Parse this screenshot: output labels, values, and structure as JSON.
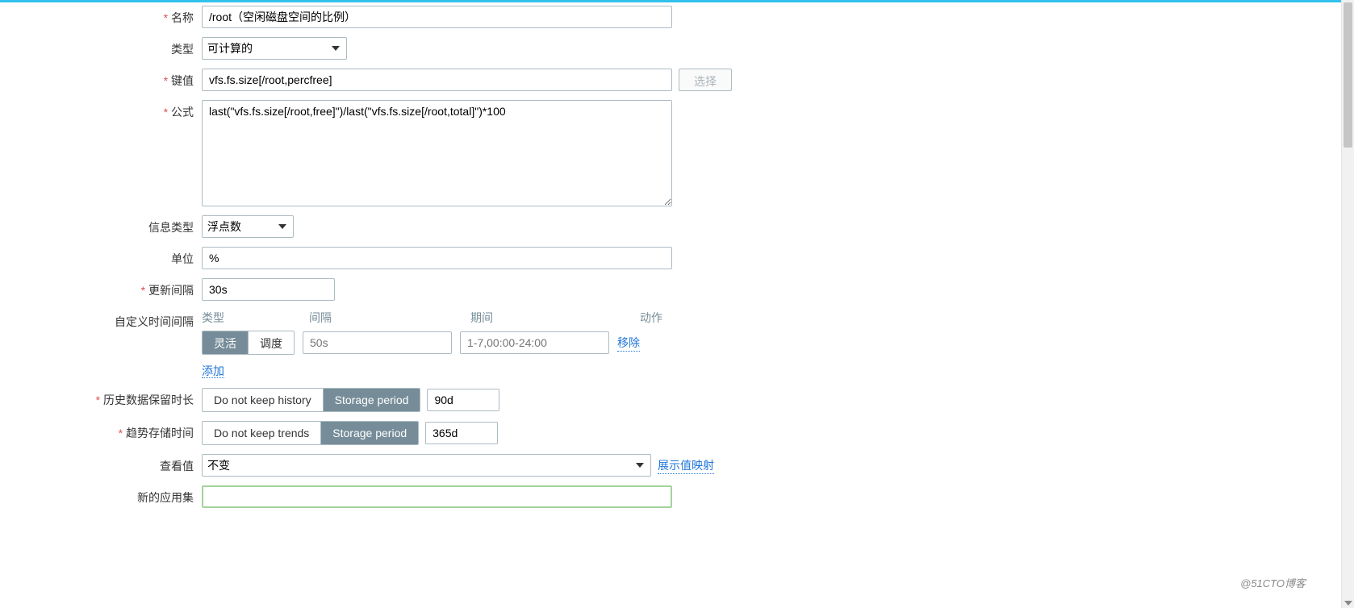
{
  "form": {
    "name": {
      "label": "名称",
      "value": "/root（空闲磁盘空间的比例）"
    },
    "type": {
      "label": "类型",
      "value": "可计算的"
    },
    "key": {
      "label": "键值",
      "value": "vfs.fs.size[/root,percfree]",
      "select_btn": "选择"
    },
    "formula": {
      "label": "公式",
      "value": "last(\"vfs.fs.size[/root,free]\")/last(\"vfs.fs.size[/root,total]\")*100"
    },
    "info_type": {
      "label": "信息类型",
      "value": "浮点数"
    },
    "unit": {
      "label": "单位",
      "value": "%"
    },
    "update_interval": {
      "label": "更新间隔",
      "value": "30s"
    },
    "custom_intervals": {
      "label": "自定义时间间隔",
      "headers": {
        "type": "类型",
        "interval": "间隔",
        "period": "期间",
        "action": "动作"
      },
      "type_options": {
        "flexible": "灵活",
        "scheduling": "调度"
      },
      "type_selected": "flexible",
      "interval_placeholder": "50s",
      "interval_value": "",
      "period_placeholder": "1-7,00:00-24:00",
      "period_value": "",
      "remove": "移除",
      "add": "添加"
    },
    "history": {
      "label": "历史数据保留时长",
      "options": {
        "no_keep": "Do not keep history",
        "storage": "Storage period"
      },
      "selected": "storage",
      "value": "90d"
    },
    "trends": {
      "label": "趋势存储时间",
      "options": {
        "no_keep": "Do not keep trends",
        "storage": "Storage period"
      },
      "selected": "storage",
      "value": "365d"
    },
    "view": {
      "label": "查看值",
      "value": "不变",
      "show_map": "展示值映射"
    },
    "new_appset": {
      "label": "新的应用集",
      "value": ""
    }
  },
  "watermark": "@51CTO博客"
}
